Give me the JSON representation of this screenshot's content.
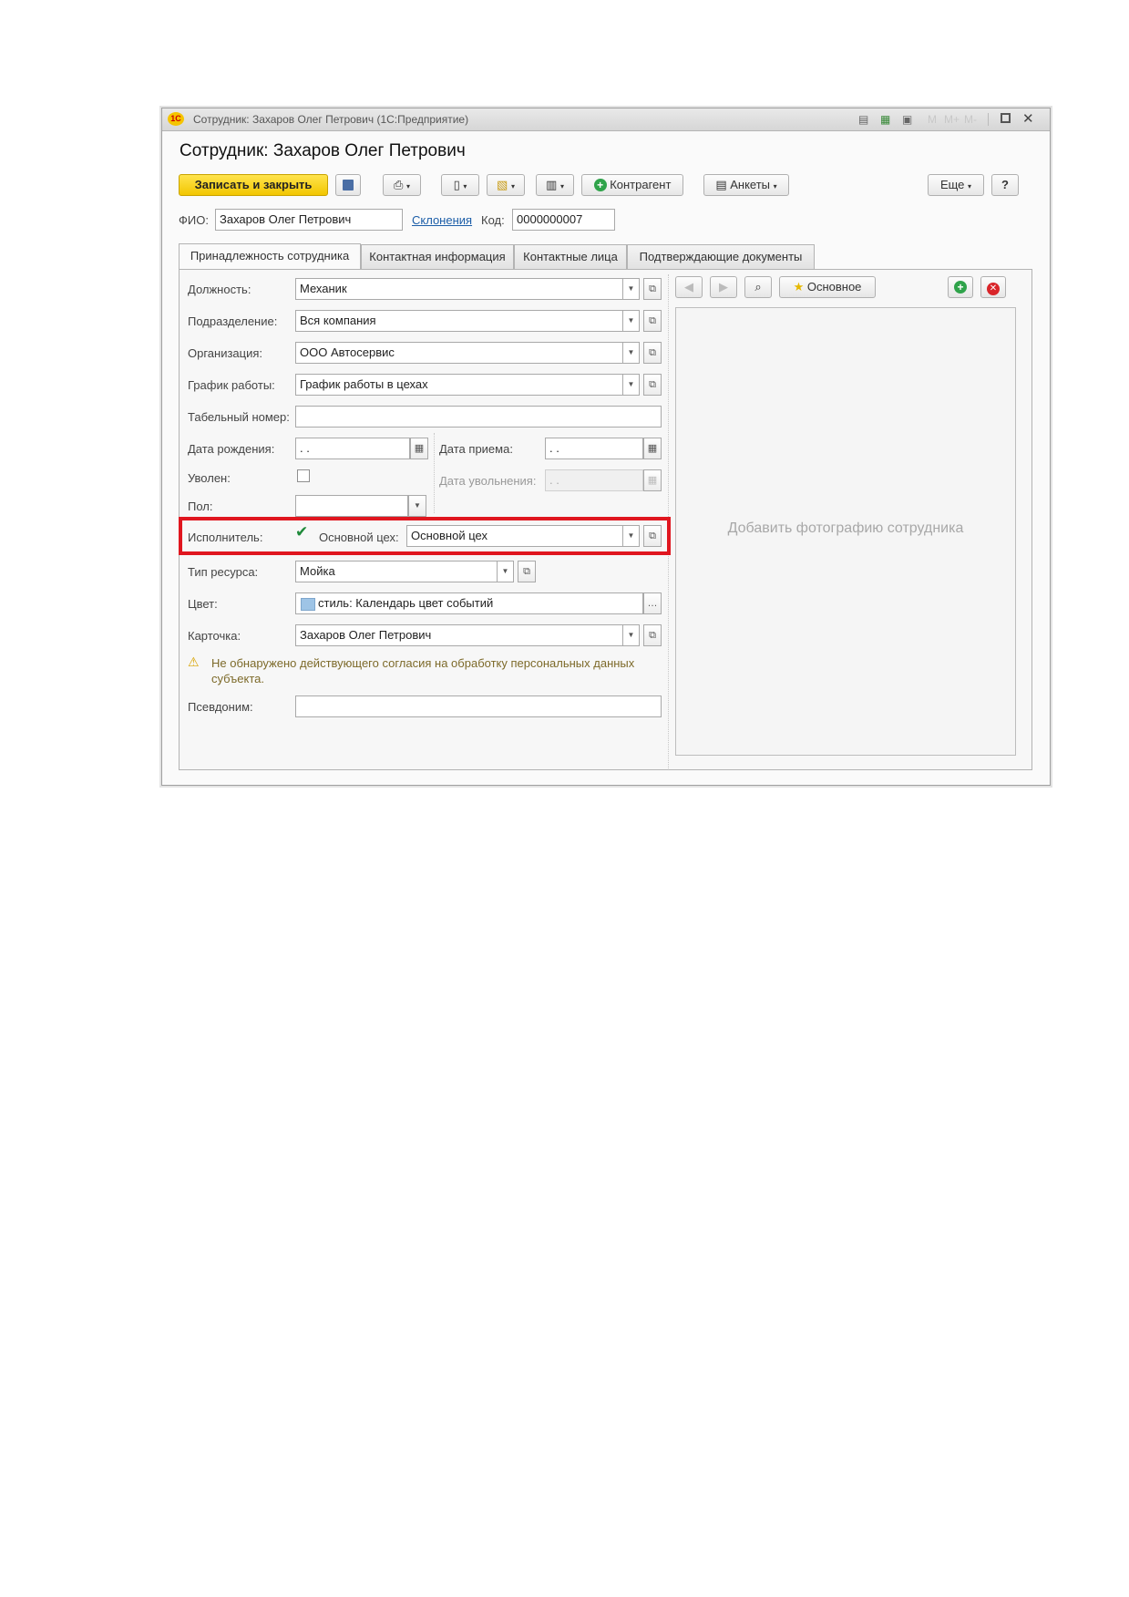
{
  "window": {
    "title": "Сотрудник: Захаров Олег Петрович  (1С:Предприятие)",
    "logo": "1С"
  },
  "form": {
    "title": "Сотрудник: Захаров Олег Петрович"
  },
  "toolbar": {
    "save_close": "Записать и закрыть",
    "counterparty": "Контрагент",
    "questionnaires": "Анкеты",
    "more": "Еще",
    "help": "?"
  },
  "header": {
    "fio_label": "ФИО:",
    "fio_value": "Захаров Олег Петрович",
    "declensions_link": "Склонения",
    "code_label": "Код:",
    "code_value": "0000000007"
  },
  "tabs": [
    {
      "label": "Принадлежность сотрудника",
      "active": true
    },
    {
      "label": "Контактная информация"
    },
    {
      "label": "Контактные лица"
    },
    {
      "label": "Подтверждающие документы"
    }
  ],
  "fields": {
    "position": {
      "label": "Должность:",
      "value": "Механик"
    },
    "department": {
      "label": "Подразделение:",
      "value": "Вся компания"
    },
    "organization": {
      "label": "Организация:",
      "value": "ООО Автосервис"
    },
    "schedule": {
      "label": "График работы:",
      "value": "График работы в цехах"
    },
    "tab_number": {
      "label": "Табельный номер:",
      "value": ""
    },
    "birth_date": {
      "label": "Дата рождения:",
      "value": " .  ."
    },
    "hire_date": {
      "label": "Дата приема:",
      "value": " .  ."
    },
    "dismissed": {
      "label": "Уволен:",
      "checked": false
    },
    "dismiss_date": {
      "label": "Дата увольнения:",
      "value": " .  ."
    },
    "gender": {
      "label": "Пол:",
      "value": ""
    },
    "executor": {
      "label": "Исполнитель:",
      "checked": true
    },
    "main_shop": {
      "label": "Основной цех:",
      "value": "Основной цех"
    },
    "resource_type": {
      "label": "Тип ресурса:",
      "value": "Мойка"
    },
    "color": {
      "label": "Цвет:",
      "value": "стиль: Календарь цвет событий",
      "swatch": "#9ec4e6"
    },
    "card": {
      "label": "Карточка:",
      "value": "Захаров Олег Петрович"
    },
    "pseudonym": {
      "label": "Псевдоним:",
      "value": ""
    }
  },
  "warning": {
    "text_line1": "Не обнаружено действующего согласия на обработку персональных данных",
    "text_line2": "субъекта."
  },
  "photo": {
    "main_button": "Основное",
    "placeholder": "Добавить фотографию сотрудника"
  },
  "colors": {
    "accent_yellow": "#f2c600",
    "highlight_red": "#e0161f",
    "link_blue": "#1c5ea8",
    "add_green": "#2fa34a",
    "delete_red": "#d9252a"
  }
}
